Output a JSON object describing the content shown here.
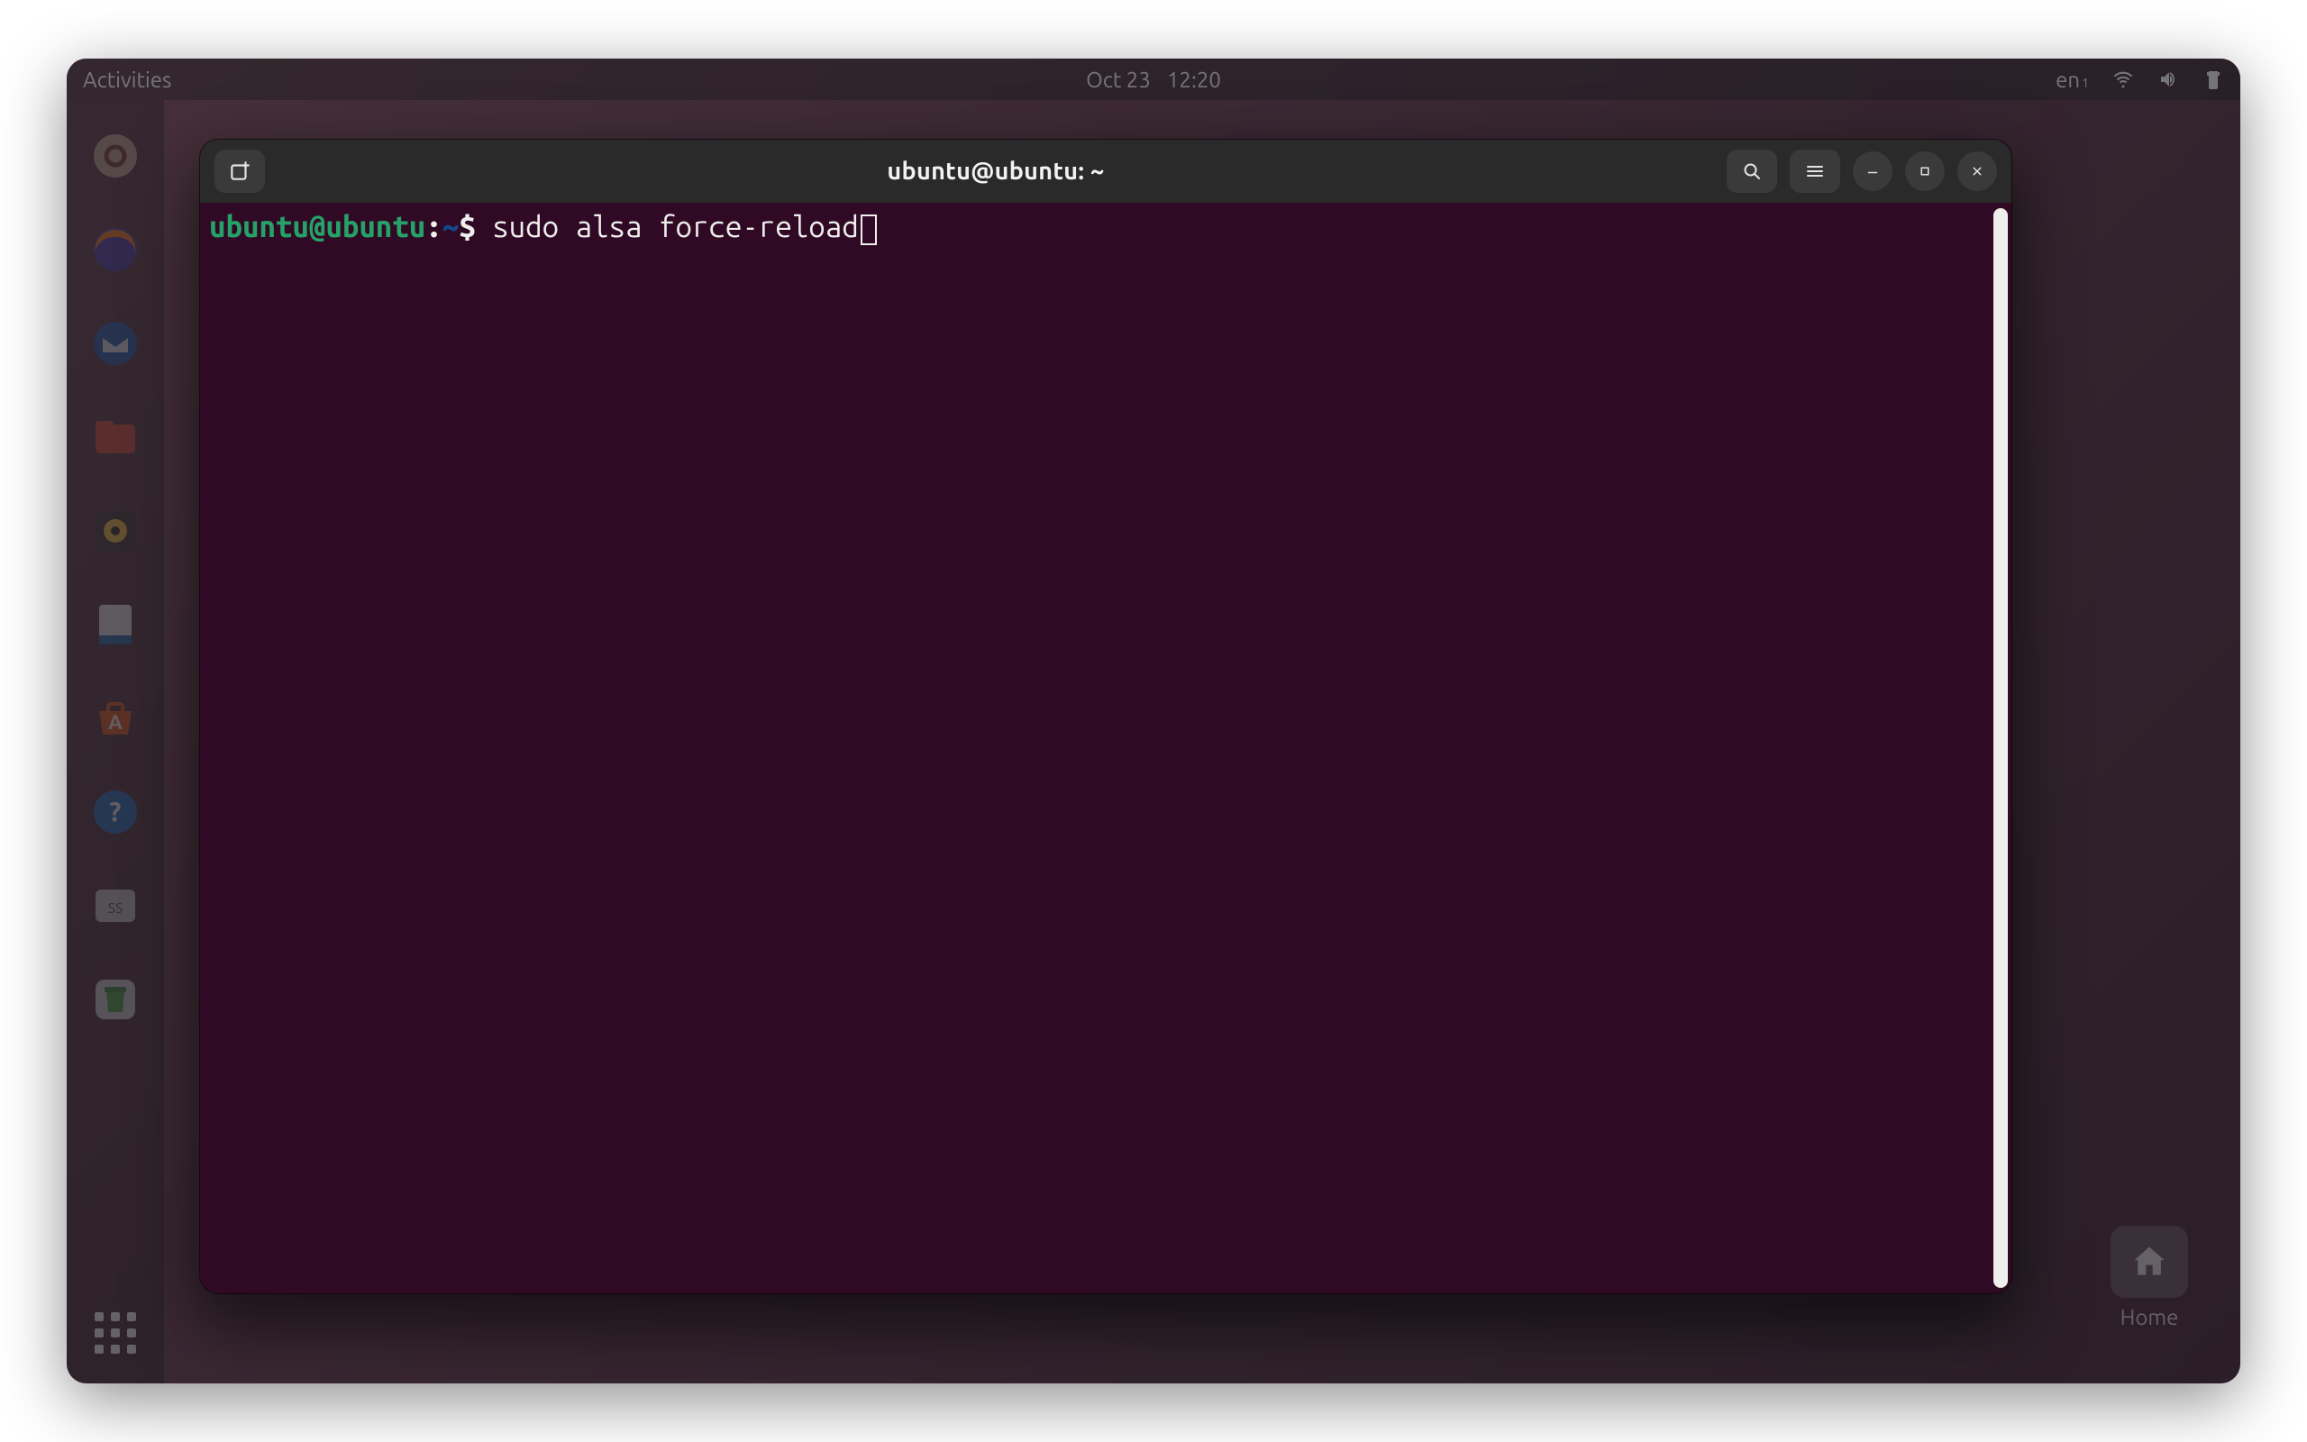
{
  "panel": {
    "activities": "Activities",
    "date": "Oct 23",
    "time": "12:20",
    "lang_code": "en",
    "lang_variant": "1"
  },
  "dock": {
    "items": [
      {
        "name": "installer-icon"
      },
      {
        "name": "firefox-icon"
      },
      {
        "name": "thunderbird-icon"
      },
      {
        "name": "files-icon"
      },
      {
        "name": "rhythmbox-icon"
      },
      {
        "name": "libreoffice-writer-icon"
      },
      {
        "name": "software-icon"
      },
      {
        "name": "help-icon"
      },
      {
        "name": "screenshots-folder-icon"
      },
      {
        "name": "trash-icon"
      }
    ],
    "apps_button_name": "show-applications-icon"
  },
  "desktop": {
    "home_label": "Home"
  },
  "terminal": {
    "title": "ubuntu@ubuntu: ~",
    "prompt": {
      "user_host": "ubuntu@ubuntu",
      "separator": ":",
      "path": "~",
      "sigil": "$ ",
      "command": "sudo alsa force-reload"
    },
    "colors": {
      "bg": "#300a24",
      "user_host": "#26a269",
      "path": "#12488b",
      "text": "#eeeeec",
      "titlebar": "#2a2a2a"
    }
  }
}
